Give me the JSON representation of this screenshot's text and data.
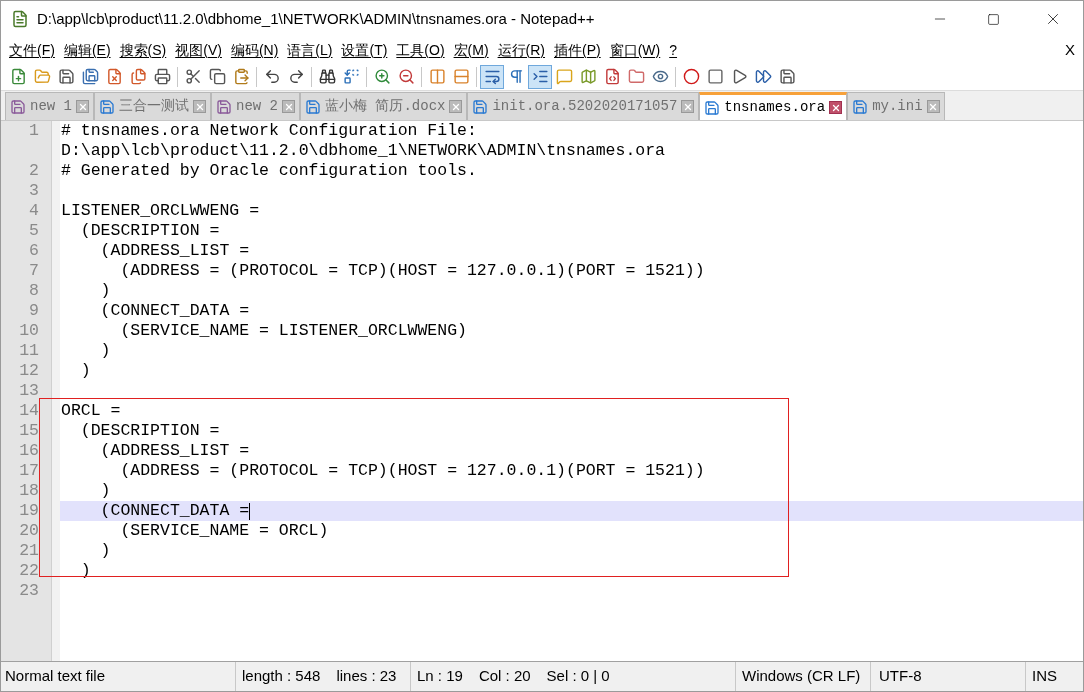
{
  "window": {
    "title": "D:\\app\\lcb\\product\\11.2.0\\dbhome_1\\NETWORK\\ADMIN\\tnsnames.ora - Notepad++"
  },
  "menu": [
    "文件(F)",
    "编辑(E)",
    "搜索(S)",
    "视图(V)",
    "编码(N)",
    "语言(L)",
    "设置(T)",
    "工具(O)",
    "宏(M)",
    "运行(R)",
    "插件(P)",
    "窗口(W)",
    "?"
  ],
  "menu_close": "X",
  "toolbar_groups": [
    [
      {
        "pressed": false
      },
      {
        "pressed": false
      },
      {
        "pressed": false
      },
      {
        "pressed": false
      },
      {
        "pressed": false
      },
      {
        "pressed": false
      },
      {
        "pressed": false
      }
    ],
    [
      {
        "pressed": false
      },
      {
        "pressed": false
      },
      {
        "pressed": false
      }
    ],
    [
      {
        "pressed": false
      },
      {
        "pressed": false
      }
    ],
    [
      {
        "pressed": false
      },
      {
        "pressed": false
      }
    ],
    [
      {
        "pressed": false
      },
      {
        "pressed": false
      }
    ],
    [
      {
        "pressed": false
      },
      {
        "pressed": false
      }
    ],
    [
      {
        "pressed": true
      },
      {
        "pressed": false
      },
      {
        "pressed": true
      },
      {
        "pressed": false
      },
      {
        "pressed": false
      },
      {
        "pressed": false
      },
      {
        "pressed": false
      },
      {
        "pressed": false
      }
    ],
    [
      {
        "pressed": false
      },
      {
        "pressed": false
      },
      {
        "pressed": false
      },
      {
        "pressed": false
      },
      {
        "pressed": false
      }
    ]
  ],
  "tabs": [
    {
      "label": "new 1",
      "selected": false,
      "modified": true
    },
    {
      "label": "三合一测试",
      "selected": false,
      "modified": false
    },
    {
      "label": "new 2",
      "selected": false,
      "modified": true
    },
    {
      "label": "蓝小梅 简历.docx",
      "selected": false,
      "modified": false
    },
    {
      "label": "init.ora.5202020171057",
      "selected": false,
      "modified": false
    },
    {
      "label": "tnsnames.ora",
      "selected": true,
      "modified": false
    },
    {
      "label": "my.ini",
      "selected": false,
      "modified": false
    }
  ],
  "editor": {
    "blocks": [
      {
        "framed": false,
        "lines": [
          {
            "number": "1",
            "rows": [
              "# tnsnames.ora Network Configuration File:",
              "D:\\app\\lcb\\product\\11.2.0\\dbhome_1\\NETWORK\\ADMIN\\tnsnames.ora"
            ],
            "current": false
          },
          {
            "number": "2",
            "rows": [
              "# Generated by Oracle configuration tools."
            ],
            "current": false
          },
          {
            "number": "3",
            "rows": [
              ""
            ],
            "current": false
          },
          {
            "number": "4",
            "rows": [
              "LISTENER_ORCLWWENG ="
            ],
            "current": false
          },
          {
            "number": "5",
            "rows": [
              "  (DESCRIPTION ="
            ],
            "current": false
          },
          {
            "number": "6",
            "rows": [
              "    (ADDRESS_LIST ="
            ],
            "current": false
          },
          {
            "number": "7",
            "rows": [
              "      (ADDRESS = (PROTOCOL = TCP)(HOST = 127.0.0.1)(PORT = 1521))"
            ],
            "current": false
          },
          {
            "number": "8",
            "rows": [
              "    )"
            ],
            "current": false
          },
          {
            "number": "9",
            "rows": [
              "    (CONNECT_DATA ="
            ],
            "current": false
          },
          {
            "number": "10",
            "rows": [
              "      (SERVICE_NAME = LISTENER_ORCLWWENG)"
            ],
            "current": false
          },
          {
            "number": "11",
            "rows": [
              "    )"
            ],
            "current": false
          },
          {
            "number": "12",
            "rows": [
              "  )"
            ],
            "current": false
          },
          {
            "number": "13",
            "rows": [
              ""
            ],
            "current": false
          }
        ]
      },
      {
        "framed": true,
        "lines": [
          {
            "number": "14",
            "rows": [
              "ORCL ="
            ],
            "current": false
          },
          {
            "number": "15",
            "rows": [
              "  (DESCRIPTION ="
            ],
            "current": false
          },
          {
            "number": "16",
            "rows": [
              "    (ADDRESS_LIST ="
            ],
            "current": false
          },
          {
            "number": "17",
            "rows": [
              "      (ADDRESS = (PROTOCOL = TCP)(HOST = 127.0.0.1)(PORT = 1521))"
            ],
            "current": false
          },
          {
            "number": "18",
            "rows": [
              "    )"
            ],
            "current": false
          },
          {
            "number": "19",
            "rows": [
              "    (CONNECT_DATA ="
            ],
            "current": true
          },
          {
            "number": "20",
            "rows": [
              "      (SERVICE_NAME = ORCL)"
            ],
            "current": false
          },
          {
            "number": "21",
            "rows": [
              "    )"
            ],
            "current": false
          },
          {
            "number": "22",
            "rows": [
              "  )"
            ],
            "current": false
          }
        ]
      },
      {
        "framed": false,
        "lines": [
          {
            "number": "23",
            "rows": [
              ""
            ],
            "current": false
          }
        ]
      }
    ]
  },
  "status_bar": {
    "file_type": "Normal text file",
    "length": "length : 548",
    "lines": "lines : 23",
    "ln": "Ln : 19",
    "col": "Col : 20",
    "sel": "Sel : 0 | 0",
    "eol": "Windows (CR LF)",
    "encoding": "UTF-8",
    "mode": "INS"
  }
}
